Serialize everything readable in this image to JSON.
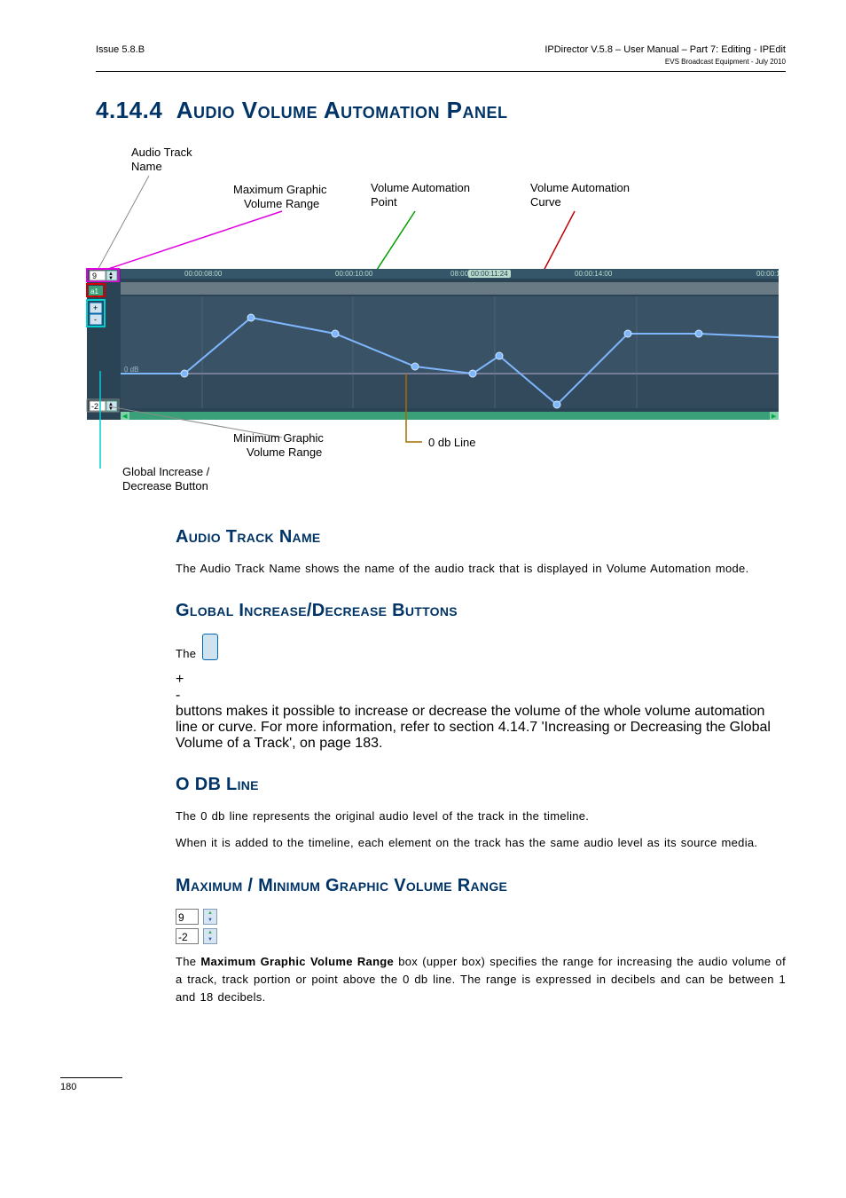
{
  "header": {
    "left": "Issue 5.8.B",
    "right": "IPDirector V.5.8 – User Manual – Part 7: Editing - IPEdit",
    "subright": "EVS Broadcast Equipment -   July 2010"
  },
  "h1_num": "4.14.4",
  "h1_text": "Audio Volume Automation Panel",
  "diagram": {
    "labels": {
      "audio_track_name": "Audio Track\nName",
      "max_range": "Maximum Graphic\nVolume Range",
      "vol_point": "Volume Automation\nPoint",
      "vol_curve": "Volume Automation\nCurve",
      "min_range": "Minimum Graphic\nVolume Range",
      "zero_db": "0 db Line",
      "global_btn": "Global Increase /\nDecrease Button"
    },
    "timecodes": [
      "00:00:08:00",
      "00:00:10:00",
      "08:00",
      "00:00:11:24",
      "00:00:14:00",
      "00:00:1"
    ],
    "top_spinner": "9",
    "bot_spinner": "-2",
    "track_label": "a1",
    "zero_label": "0 dB"
  },
  "s1": {
    "h": "Audio Track Name",
    "p": "The Audio Track Name shows the name of the audio track that is displayed in Volume Automation mode."
  },
  "s2": {
    "h": "Global Increase/Decrease Buttons",
    "p_a": "The ",
    "p_b": " buttons makes it possible to increase or decrease the volume of the whole volume automation line or curve. For more information, refer to section 4.14.7 'Increasing or Decreasing the Global Volume of a Track', on page 183."
  },
  "s3": {
    "h": "O DB Line",
    "p1": "The 0 db line represents the original audio level of the track in the timeline.",
    "p2": "When it is added to the timeline, each element on the track has the same audio level as its source media."
  },
  "s4": {
    "h": "Maximum / Minimum Graphic Volume Range",
    "spinner1": "9",
    "spinner2": "-2",
    "p_a": "The ",
    "p_bold": "Maximum Graphic Volume Range",
    "p_b": " box (upper box) specifies the range for increasing the audio volume of a track, track portion or point above the 0 db line. The range is expressed in decibels and can be between 1 and 18 decibels."
  },
  "footer": "180"
}
